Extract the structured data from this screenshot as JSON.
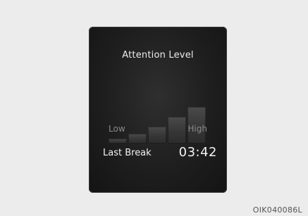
{
  "screen": {
    "title": "Attention Level",
    "scale": {
      "low_label": "Low",
      "high_label": "High",
      "level_count": 5
    },
    "last_break": {
      "label": "Last Break",
      "value": "03:42"
    }
  },
  "figure_code": "OIK040086L",
  "colors": {
    "screen_background": "#1e1e1e",
    "page_background": "#ececec",
    "text_primary": "#f2f2f2",
    "text_secondary": "#8a8a8a"
  }
}
